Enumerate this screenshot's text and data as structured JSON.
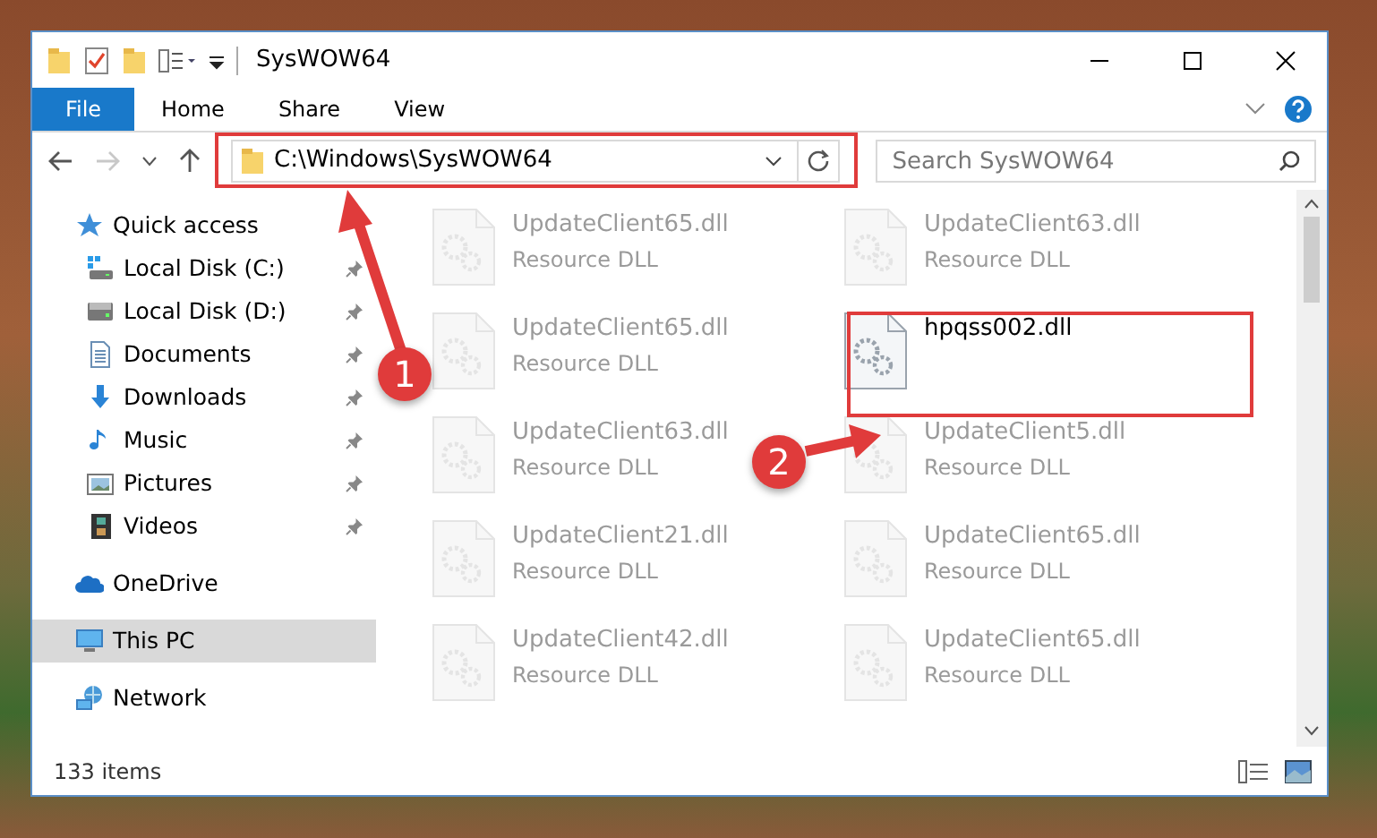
{
  "window": {
    "title": "SysWOW64"
  },
  "ribbon_tabs": [
    {
      "label": "File",
      "selected": true
    },
    {
      "label": "Home",
      "selected": false
    },
    {
      "label": "Share",
      "selected": false
    },
    {
      "label": "View",
      "selected": false
    }
  ],
  "address": {
    "path": "C:\\Windows\\SysWOW64"
  },
  "search": {
    "placeholder": "Search SysWOW64"
  },
  "sidebar": {
    "items": [
      {
        "label": "Quick access",
        "kind": "star",
        "selected": false,
        "children": [
          {
            "label": "Local Disk (C:)",
            "kind": "drive-windows",
            "pinned": true,
            "selected": false
          },
          {
            "label": "Local Disk (D:)",
            "kind": "drive",
            "pinned": true,
            "selected": false
          },
          {
            "label": "Documents",
            "kind": "document",
            "pinned": true,
            "selected": false
          },
          {
            "label": "Downloads",
            "kind": "download",
            "pinned": true,
            "selected": false
          },
          {
            "label": "Music",
            "kind": "music",
            "pinned": true,
            "selected": false
          },
          {
            "label": "Pictures",
            "kind": "picture",
            "pinned": true,
            "selected": false
          },
          {
            "label": "Videos",
            "kind": "film",
            "pinned": true,
            "selected": false
          }
        ]
      },
      {
        "label": "OneDrive",
        "kind": "cloud",
        "selected": false
      },
      {
        "label": "This PC",
        "kind": "monitor",
        "selected": true
      },
      {
        "label": "Network",
        "kind": "network",
        "selected": false
      }
    ]
  },
  "files": [
    {
      "name": "UpdateClient65.dll",
      "type": "Resource DLL",
      "faded": true
    },
    {
      "name": "UpdateClient63.dll",
      "type": "Resource DLL",
      "faded": true
    },
    {
      "name": "UpdateClient65.dll",
      "type": "Resource DLL",
      "faded": true
    },
    {
      "name": "hpqss002.dll",
      "faded": false
    },
    {
      "name": "UpdateClient63.dll",
      "type": "Resource DLL",
      "faded": true
    },
    {
      "name": "UpdateClient5.dll",
      "type": "Resource DLL",
      "faded": true
    },
    {
      "name": "UpdateClient21.dll",
      "type": "Resource DLL",
      "faded": true
    },
    {
      "name": "UpdateClient65.dll",
      "type": "Resource DLL",
      "faded": true
    },
    {
      "name": "UpdateClient42.dll",
      "type": "Resource DLL",
      "faded": true
    },
    {
      "name": "UpdateClient65.dll",
      "type": "Resource DLL",
      "faded": true
    }
  ],
  "status_bar": {
    "item_count": "133 items"
  },
  "annotations": [
    {
      "number": "1"
    },
    {
      "number": "2"
    }
  ]
}
